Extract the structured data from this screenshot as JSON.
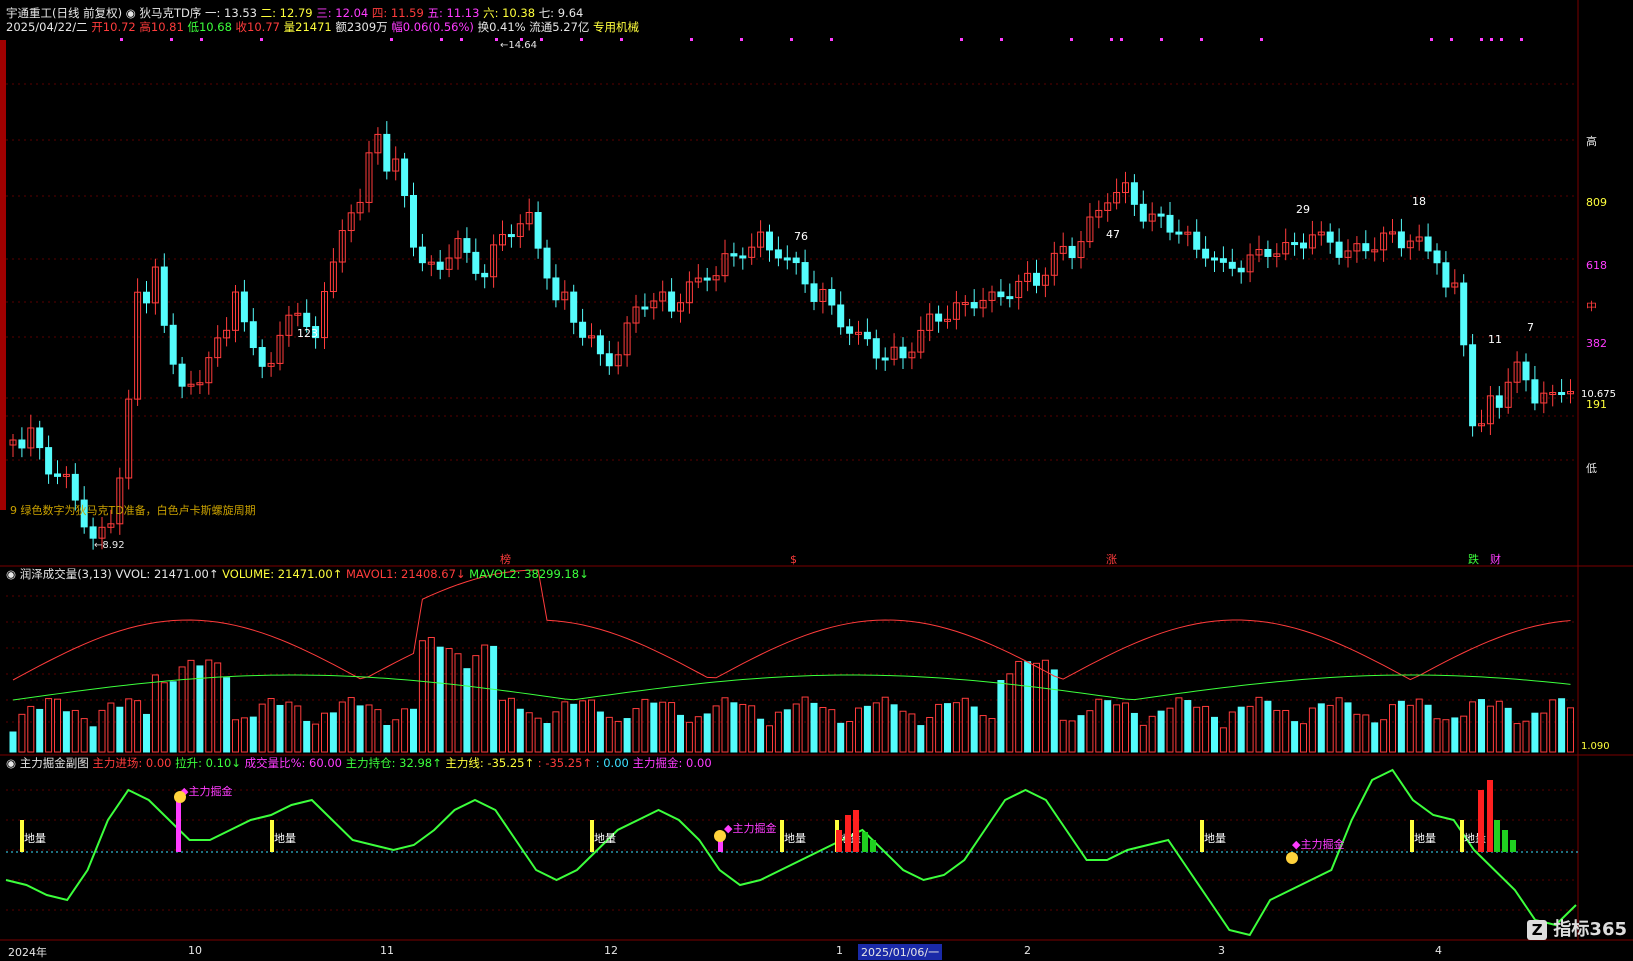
{
  "header": {
    "line1": [
      {
        "t": "宇通重工(日线 前复权)",
        "c": "w"
      },
      {
        "t": "◉ 狄马克TD序",
        "c": "w"
      },
      {
        "t": "一: 13.53",
        "c": "w"
      },
      {
        "t": "二: 12.79",
        "c": "y"
      },
      {
        "t": "三: 12.04",
        "c": "m"
      },
      {
        "t": "四: 11.59",
        "c": "r"
      },
      {
        "t": "五: 11.13",
        "c": "m"
      },
      {
        "t": "六: 10.38",
        "c": "y"
      },
      {
        "t": "七: 9.64",
        "c": "w"
      }
    ],
    "line2": [
      {
        "t": "2025/04/22/二",
        "c": "w"
      },
      {
        "t": "开10.72",
        "c": "r"
      },
      {
        "t": "高10.81",
        "c": "r"
      },
      {
        "t": "低10.68",
        "c": "g"
      },
      {
        "t": "收10.77",
        "c": "r"
      },
      {
        "t": "量21471",
        "c": "y"
      },
      {
        "t": "额2309万",
        "c": "w"
      },
      {
        "t": "幅0.06(0.56%)",
        "c": "m"
      },
      {
        "t": "换0.41%",
        "c": "w"
      },
      {
        "t": "流通5.27亿",
        "c": "w"
      },
      {
        "t": "专用机械",
        "c": "y"
      }
    ]
  },
  "main": {
    "high_label": "14.64",
    "low_label": "8.92",
    "note": "9  绿色数字为狄马克TD准备，白色卢卡斯螺旋周期",
    "right_levels": [
      {
        "t": "高",
        "c": "w"
      },
      {
        "t": "809",
        "c": "y"
      },
      {
        "t": "618",
        "c": "m"
      },
      {
        "t": "中",
        "c": "r"
      },
      {
        "t": "382",
        "c": "m"
      },
      {
        "t": "191",
        "c": "y"
      },
      {
        "t": "低",
        "c": "w"
      }
    ],
    "price_tag": "10.675",
    "white_nums": [
      "123",
      "76",
      "47",
      "29",
      "18",
      "11",
      "7"
    ],
    "markers": [
      "榜",
      "$",
      "涨",
      "跌",
      "财"
    ]
  },
  "vol": {
    "title": "◉ 润泽成交量(3,13)",
    "items": [
      {
        "t": "VVOL: 21471.00↑",
        "c": "w"
      },
      {
        "t": "VOLUME: 21471.00↑",
        "c": "y"
      },
      {
        "t": "MAVOL1: 21408.67↓",
        "c": "r"
      },
      {
        "t": "MAVOL2: 38299.18↓",
        "c": "g"
      }
    ],
    "right_val": "1.090"
  },
  "sub": {
    "title": "◉ 主力掘金副图",
    "items": [
      {
        "t": "主力进场: 0.00",
        "c": "r"
      },
      {
        "t": "拉升: 0.10↓",
        "c": "g"
      },
      {
        "t": "成交量比%: 60.00",
        "c": "m"
      },
      {
        "t": "主力持仓: 32.98↑",
        "c": "g"
      },
      {
        "t": "主力线: -35.25↑",
        "c": "y"
      },
      {
        "t": ": -35.25↑",
        "c": "r"
      },
      {
        "t": ": 0.00",
        "c": "c"
      },
      {
        "t": "主力掘金: 0.00",
        "c": "m"
      }
    ],
    "zone_label": "地量",
    "jin_label": "主力掘金"
  },
  "xaxis": {
    "labels": [
      "2024年",
      "10",
      "11",
      "12",
      "1",
      "2025/01/06/一",
      "2",
      "3",
      "4"
    ]
  },
  "brand": "指标365",
  "colors": {
    "up": "#ff3c3c",
    "down": "#54fcfc",
    "grid": "#7a0000",
    "bg": "#000000"
  }
}
